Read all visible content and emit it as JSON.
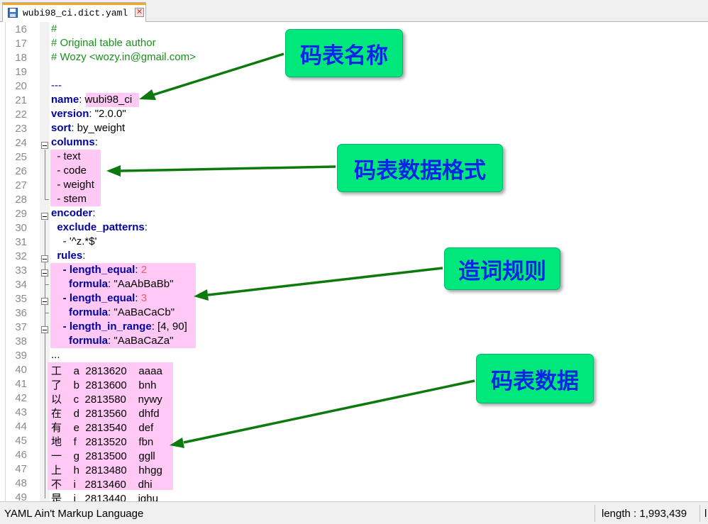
{
  "tab": {
    "title": "wubi98_ci.dict.yaml",
    "file_icon": "save-disk-icon",
    "close_icon": "close-icon"
  },
  "lines": [
    {
      "n": "16",
      "t": [
        [
          "cm",
          "#"
        ]
      ]
    },
    {
      "n": "17",
      "t": [
        [
          "cm",
          "# Original table author"
        ]
      ]
    },
    {
      "n": "18",
      "t": [
        [
          "cm",
          "# Wozy <wozy.in@gmail.com>"
        ]
      ]
    },
    {
      "n": "19",
      "t": []
    },
    {
      "n": "20",
      "t": [
        [
          "ddd",
          "---"
        ]
      ]
    },
    {
      "n": "21",
      "t": [
        [
          "key",
          "name"
        ],
        [
          "",
          ": wubi98_ci"
        ]
      ]
    },
    {
      "n": "22",
      "t": [
        [
          "key",
          "version"
        ],
        [
          "",
          ": \"2.0.0\""
        ]
      ]
    },
    {
      "n": "23",
      "t": [
        [
          "key",
          "sort"
        ],
        [
          "",
          ": by_weight"
        ]
      ]
    },
    {
      "n": "24",
      "t": [
        [
          "key",
          "columns"
        ],
        [
          "",
          ":"
        ]
      ]
    },
    {
      "n": "25",
      "t": [
        [
          "",
          "  - text"
        ]
      ]
    },
    {
      "n": "26",
      "t": [
        [
          "",
          "  - code"
        ]
      ]
    },
    {
      "n": "27",
      "t": [
        [
          "",
          "  - weight"
        ]
      ]
    },
    {
      "n": "28",
      "t": [
        [
          "",
          "  - stem"
        ]
      ]
    },
    {
      "n": "29",
      "t": [
        [
          "key",
          "encoder"
        ],
        [
          "",
          ":"
        ]
      ]
    },
    {
      "n": "30",
      "t": [
        [
          "",
          "  "
        ],
        [
          "key",
          "exclude_patterns"
        ],
        [
          "",
          ":"
        ]
      ]
    },
    {
      "n": "31",
      "t": [
        [
          "",
          "    - '^z.*$'"
        ]
      ]
    },
    {
      "n": "32",
      "t": [
        [
          "",
          "  "
        ],
        [
          "key",
          "rules"
        ],
        [
          "",
          ":"
        ]
      ]
    },
    {
      "n": "33",
      "t": [
        [
          "",
          "    "
        ],
        [
          "key",
          "- length_equal"
        ],
        [
          "",
          ": "
        ],
        [
          "num",
          "2"
        ]
      ]
    },
    {
      "n": "34",
      "t": [
        [
          "",
          "      "
        ],
        [
          "key",
          "formula"
        ],
        [
          "",
          ": \"AaAbBaBb\""
        ]
      ]
    },
    {
      "n": "35",
      "t": [
        [
          "",
          "    "
        ],
        [
          "key",
          "- length_equal"
        ],
        [
          "",
          ": "
        ],
        [
          "num",
          "3"
        ]
      ]
    },
    {
      "n": "36",
      "t": [
        [
          "",
          "      "
        ],
        [
          "key",
          "formula"
        ],
        [
          "",
          ": \"AaBaCaCb\""
        ]
      ]
    },
    {
      "n": "37",
      "t": [
        [
          "",
          "    "
        ],
        [
          "key",
          "- length_in_range"
        ],
        [
          "",
          ": [4, 90]"
        ]
      ]
    },
    {
      "n": "38",
      "t": [
        [
          "",
          "      "
        ],
        [
          "key",
          "formula"
        ],
        [
          "",
          ": \"AaBaCaZa\""
        ]
      ]
    },
    {
      "n": "39",
      "t": [
        [
          "",
          "..."
        ]
      ]
    },
    {
      "n": "40",
      "t": [
        [
          "",
          "工    a  2813620    aaaa"
        ]
      ]
    },
    {
      "n": "41",
      "t": [
        [
          "",
          "了    b  2813600    bnh"
        ]
      ]
    },
    {
      "n": "42",
      "t": [
        [
          "",
          "以    c  2813580    nywy"
        ]
      ]
    },
    {
      "n": "43",
      "t": [
        [
          "",
          "在    d  2813560    dhfd"
        ]
      ]
    },
    {
      "n": "44",
      "t": [
        [
          "",
          "有    e  2813540    def"
        ]
      ]
    },
    {
      "n": "45",
      "t": [
        [
          "",
          "地    f   2813520    fbn"
        ]
      ]
    },
    {
      "n": "46",
      "t": [
        [
          "",
          "一    g  2813500    ggll"
        ]
      ]
    },
    {
      "n": "47",
      "t": [
        [
          "",
          "上    h  2813480    hhgg"
        ]
      ]
    },
    {
      "n": "48",
      "t": [
        [
          "",
          "不    i   2813460    dhi"
        ]
      ]
    },
    {
      "n": "49",
      "t": [
        [
          "",
          "是    j   2813440    jghu"
        ]
      ]
    }
  ],
  "annotations": {
    "table_name": "码表名称",
    "data_format": "码表数据格式",
    "word_rules": "造词规则",
    "table_data": "码表数据"
  },
  "colors": {
    "annotation_bg": "#00e87c",
    "annotation_text": "#0a24e8",
    "highlight": "#ffc8f5",
    "arrow": "#0c7a0c"
  },
  "status": {
    "language": "YAML Ain't Markup Language",
    "length": "length : 1,993,439",
    "next": "l"
  }
}
